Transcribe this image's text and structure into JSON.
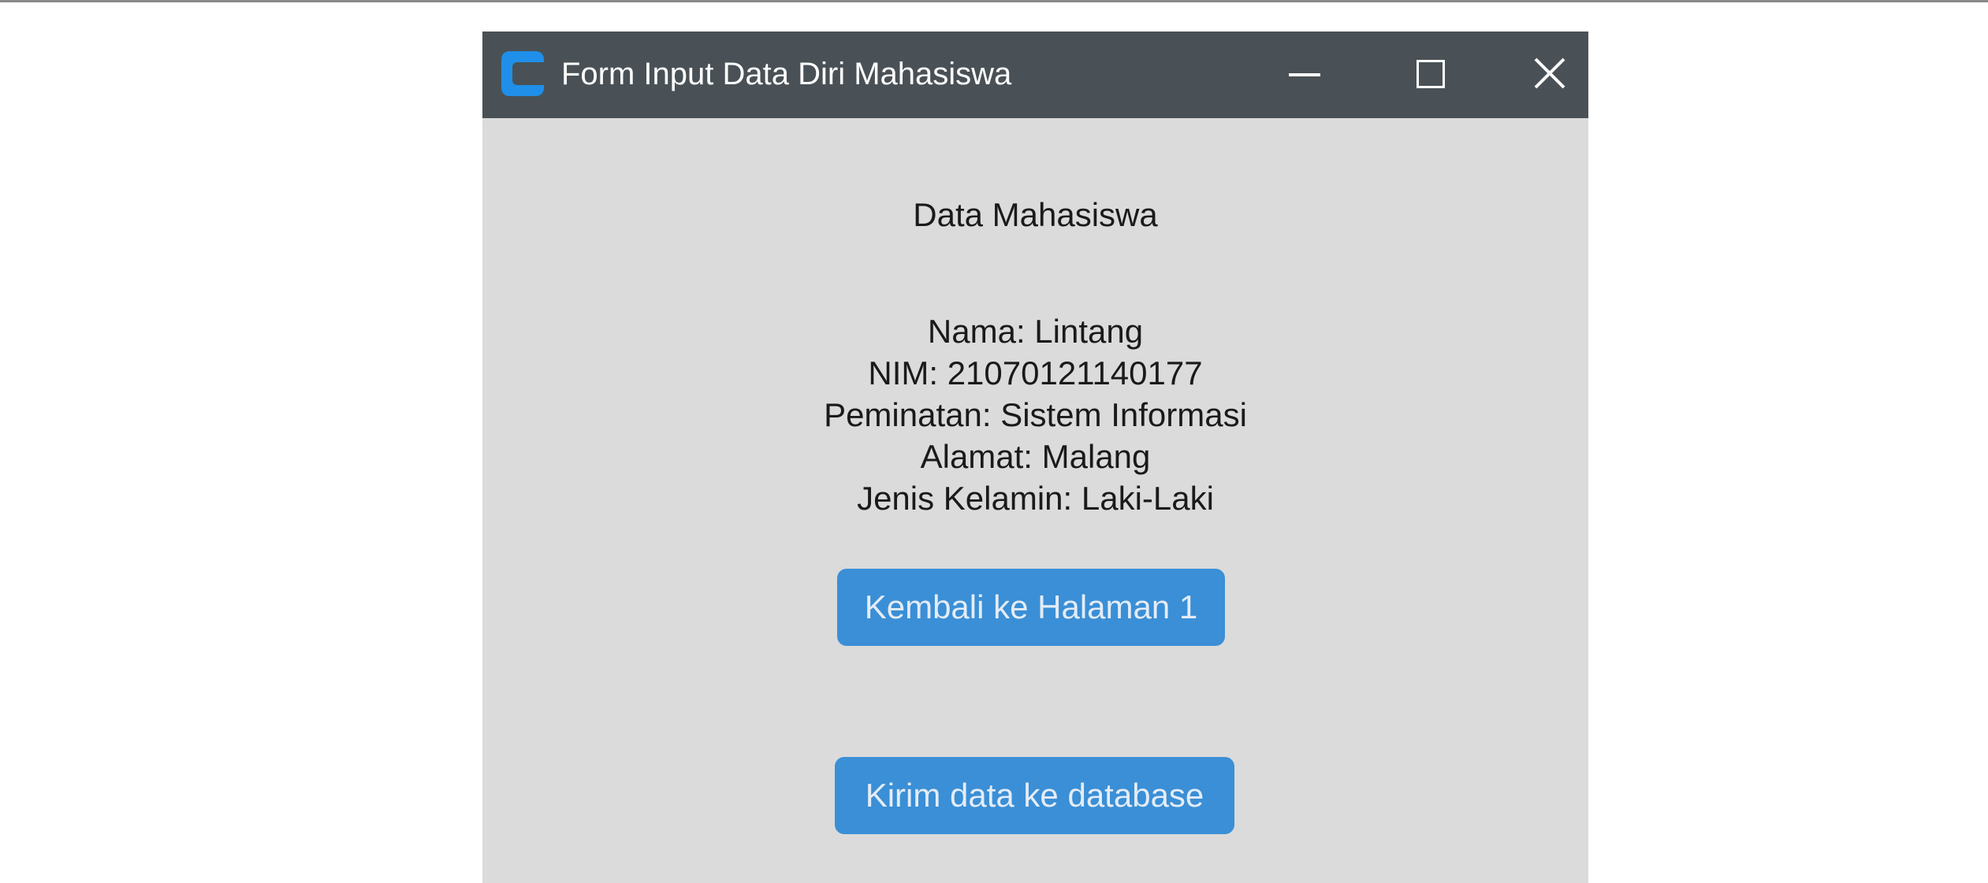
{
  "window": {
    "title": "Form Input Data Diri Mahasiswa",
    "icon": "app-icon",
    "controls": [
      "minimize-icon",
      "maximize-icon",
      "close-icon"
    ]
  },
  "main": {
    "heading": "Data Mahasiswa",
    "info_lines": [
      "Nama: Lintang",
      "NIM: 21070121140177",
      "Peminatan: Sistem Informasi",
      "Alamat: Malang",
      "Jenis Kelamin: Laki-Laki"
    ],
    "back_button_label": "Kembali ke Halaman 1",
    "send_button_label": "Kirim data ke database"
  },
  "colors": {
    "titlebar": "#495156",
    "window_bg": "#dbdbdb",
    "accent": "#3a8fd6",
    "app_icon": "#1f8fea"
  }
}
